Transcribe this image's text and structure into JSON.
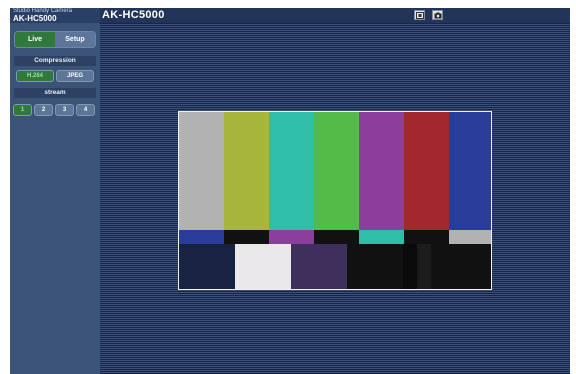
{
  "header": {
    "product_name": "Studio Handy Camera",
    "model": "AK-HC5000",
    "title": "AK-HC5000",
    "toolbar_icons": [
      {
        "name": "snapshot-icon",
        "glyph": "▣"
      },
      {
        "name": "camera-icon",
        "glyph": "◙"
      }
    ]
  },
  "sidebar": {
    "mode_tabs": [
      "Live",
      "Setup"
    ],
    "active_mode": "Live",
    "compression": {
      "label": "Compression",
      "options": [
        "H.264",
        "JPEG"
      ],
      "selected": "H.264"
    },
    "stream": {
      "label": "stream",
      "options": [
        "1",
        "2",
        "3",
        "4"
      ],
      "selected": "1"
    }
  },
  "video": {
    "content": "color-bars",
    "top_bars": [
      "#b2b2b2",
      "#a7b53a",
      "#2fbea7",
      "#53bb47",
      "#8b3e9c",
      "#a3282e",
      "#283d9a"
    ],
    "mid_bars": [
      "#283d9a",
      "#111111",
      "#8b3e9c",
      "#111111",
      "#2fbea7",
      "#111111",
      "#b2b2b2"
    ],
    "bottom_blocks": [
      "#172341",
      "#ebe8ec",
      "#3f2f5c",
      "#111111",
      "#0a0a0a",
      "#1c1c1c",
      "#111111"
    ]
  },
  "colors": {
    "accent_active": "#2f7a3a",
    "sidebar_bg": "#3a5377",
    "header_bg": "#223458"
  }
}
